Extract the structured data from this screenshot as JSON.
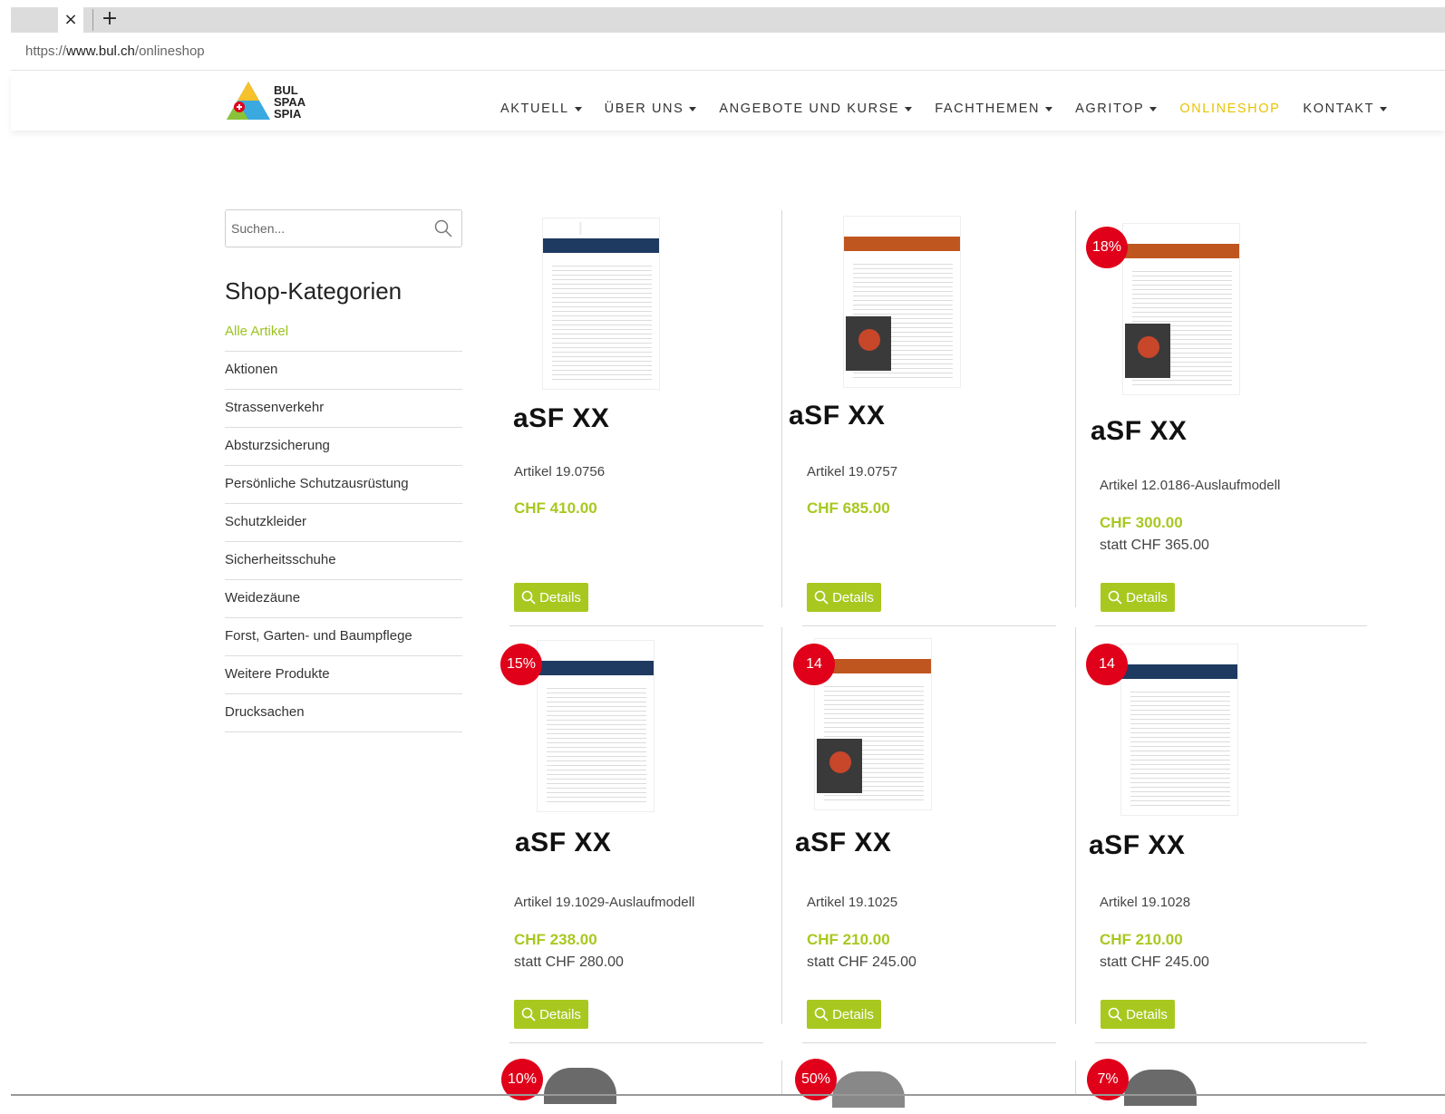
{
  "browser": {
    "close_glyph": "×",
    "newtab_glyph": "+",
    "url_prefix": "https://",
    "url_host": "www.bul.ch",
    "url_path": "/onlineshop"
  },
  "logo": {
    "line1": "BUL",
    "line2": "SPAA",
    "line3": "SPIA"
  },
  "nav": [
    {
      "label": "AKTUELL",
      "dropdown": true
    },
    {
      "label": "ÜBER UNS",
      "dropdown": true
    },
    {
      "label": "ANGEBOTE UND KURSE",
      "dropdown": true
    },
    {
      "label": "FACHTHEMEN",
      "dropdown": true
    },
    {
      "label": "AGRITOP",
      "dropdown": true
    },
    {
      "label": "ONLINESHOP",
      "dropdown": false,
      "active": true
    },
    {
      "label": "KONTAKT",
      "dropdown": true
    }
  ],
  "search": {
    "placeholder": "Suchen..."
  },
  "sidebar": {
    "title": "Shop-Kategorien",
    "items": [
      "Alle Artikel",
      "Aktionen",
      "Strassenverkehr",
      "Absturzsicherung",
      "Persönliche Schutzausrüstung",
      "Schutzkleider",
      "Sicherheitsschuhe",
      "Weidezäune",
      "Forst, Garten- und Baumpflege",
      "Weitere Produkte",
      "Drucksachen"
    ]
  },
  "products": [
    {
      "name": "aSF XX",
      "article": "Artikel 19.0756",
      "price": "CHF 410.00",
      "old_price": "",
      "badge": "",
      "button": "Details",
      "band_color": "#1e3a60"
    },
    {
      "name": "aSF XX",
      "article": "Artikel 19.0757",
      "price": "CHF 685.00",
      "old_price": "",
      "badge": "",
      "button": "Details",
      "band_color": "#c0561f"
    },
    {
      "name": "aSF XX",
      "article": "Artikel 12.0186-Auslaufmodell",
      "price": "CHF 300.00",
      "old_price": "statt CHF 365.00",
      "badge": "18%",
      "button": "Details",
      "band_color": "#c0561f"
    },
    {
      "name": "aSF XX",
      "article": "Artikel 19.1029-Auslaufmodell",
      "price": "CHF 238.00",
      "old_price": "statt CHF 280.00",
      "badge": "15%",
      "button": "Details",
      "band_color": "#1e3a60"
    },
    {
      "name": "aSF XX",
      "article": "Artikel 19.1025",
      "price": "CHF 210.00",
      "old_price": "statt CHF 245.00",
      "badge": "14",
      "button": "Details",
      "band_color": "#c0561f"
    },
    {
      "name": "aSF XX",
      "article": "Artikel 19.1028",
      "price": "CHF 210.00",
      "old_price": "statt CHF 245.00",
      "badge": "14",
      "button": "Details",
      "band_color": "#1e3a60"
    }
  ],
  "bottom_badges": [
    "10%",
    "50%",
    "7%"
  ],
  "colors": {
    "accent_green": "#a8c820",
    "active_nav": "#e8c300",
    "badge_red": "#e0001a"
  }
}
